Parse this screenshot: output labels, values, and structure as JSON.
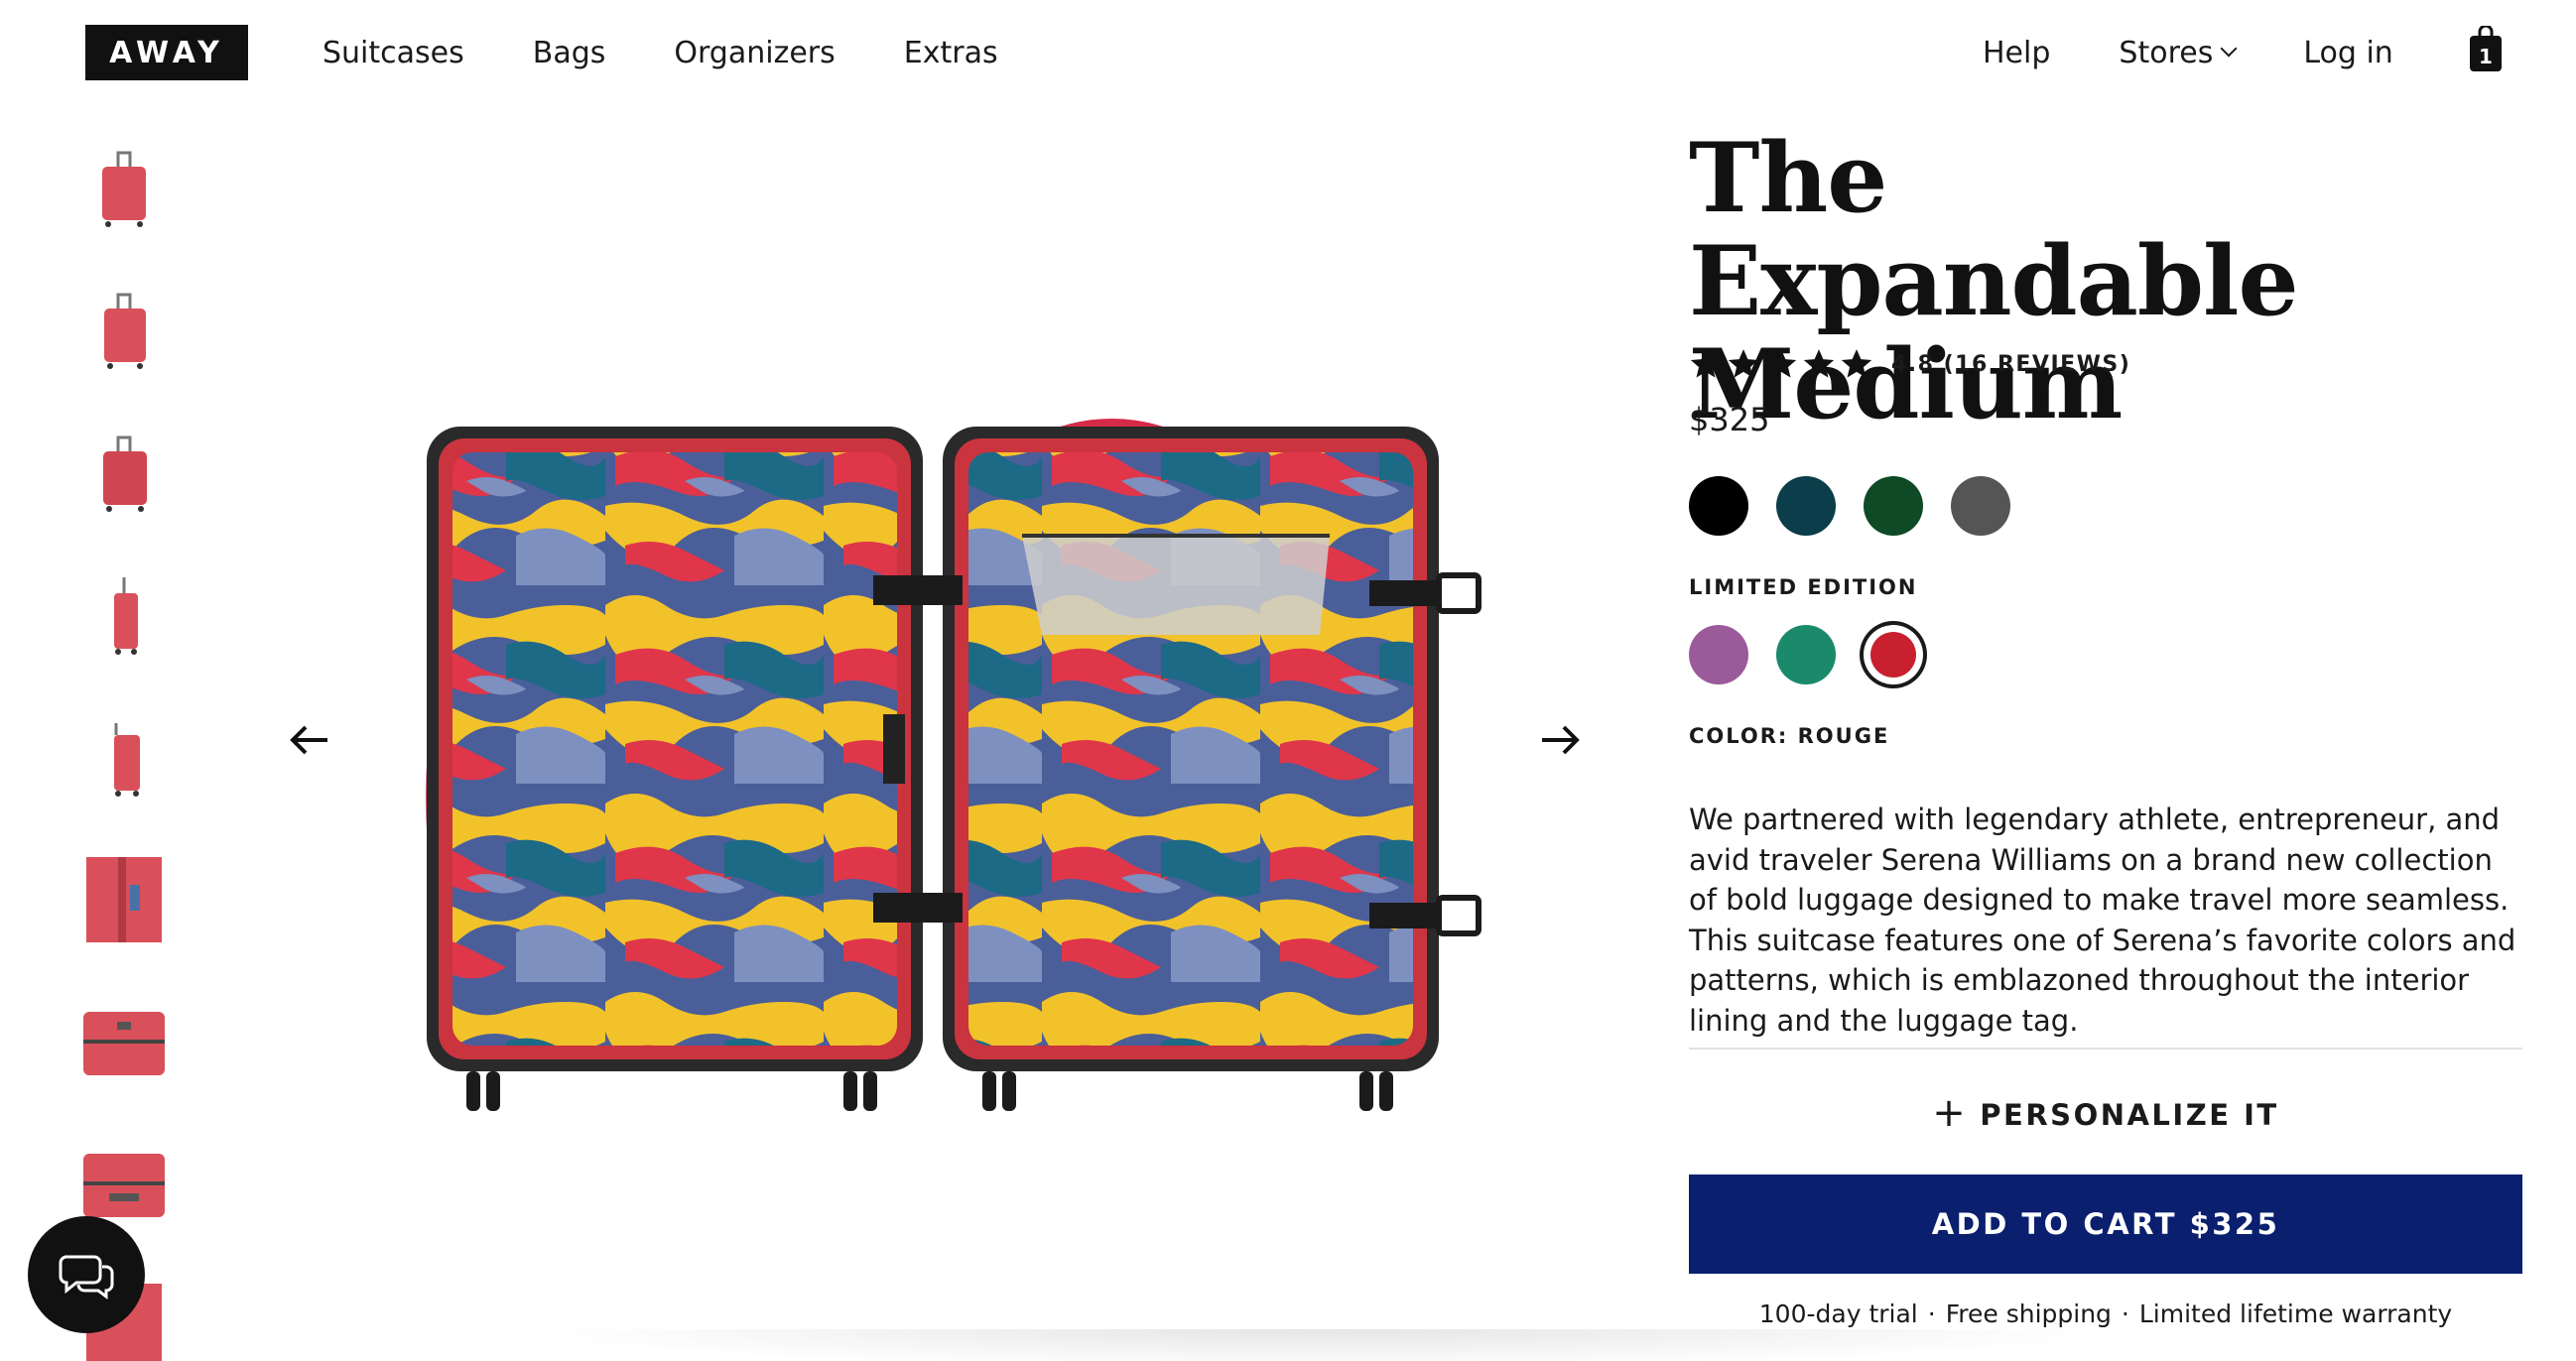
{
  "header": {
    "logo": "AWAY",
    "nav_left": [
      "Suitcases",
      "Bags",
      "Organizers",
      "Extras"
    ],
    "help": "Help",
    "stores": "Stores",
    "login": "Log in",
    "cart_count": "1"
  },
  "gallery": {
    "thumbnail_count": 9,
    "prev_icon": "arrow-left-icon",
    "next_icon": "arrow-right-icon"
  },
  "product": {
    "title_line1": "The Expandable",
    "title_line2": "Medium",
    "rating": "4.8 (16 REVIEWS)",
    "stars": 5,
    "price": "$325",
    "colors": [
      "#000000",
      "#0b3d4a",
      "#0d4a25",
      "#555555"
    ],
    "limited_label": "LIMITED EDITION",
    "limited_colors": [
      "#9b5a9a",
      "#1a8a6a",
      "#c8202e"
    ],
    "selected_color": "#c8202e",
    "color_label": "COLOR: ROUGE",
    "description": "We partnered with legendary athlete, entrepreneur, and avid traveler Serena Williams on a brand new collection of bold luggage designed to make travel more seamless. This suitcase features one of Serena’s favorite colors and patterns, which is emblazoned throughout the interior lining and the luggage tag.",
    "personalize": "PERSONALIZE IT",
    "add_to_cart": "ADD TO CART $325",
    "perks": [
      "100-day trial",
      "Free shipping",
      "Limited lifetime warranty"
    ],
    "perk_separator": "·"
  },
  "chat": {
    "icon": "chat-bubbles-icon"
  },
  "theme": {
    "cta_color": "#0a1f6e",
    "suitcase_color": "#d9505a"
  }
}
